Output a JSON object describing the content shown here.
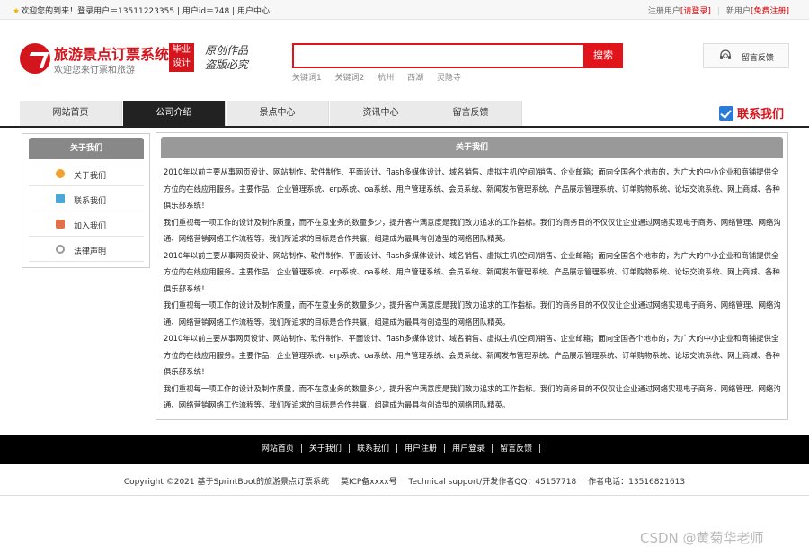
{
  "topbar": {
    "welcome": "欢迎您的到来！登录用户＝13511223355 | 用户id＝748 | 用户中心",
    "register_label": "注册用户",
    "register_link": "[请登录]",
    "new_user_label": "新用户",
    "free_register_link": "[免费注册]"
  },
  "header": {
    "title": "旅游景点订票系统",
    "subtitle": "欢迎您来订票和旅游",
    "grad_badge_line1": "毕业",
    "grad_badge_line2": "设计",
    "slogan_line1": "原创作品",
    "slogan_line2": "盗版必究",
    "search_placeholder": "",
    "search_button": "搜索",
    "keywords": [
      "关键词1",
      "关键词2",
      "杭州",
      "西湖",
      "灵隐寺"
    ],
    "feedback_button": "留言反馈"
  },
  "nav": {
    "items": [
      "网站首页",
      "公司介绍",
      "景点中心",
      "资讯中心",
      "留言反馈"
    ],
    "active_index": 1,
    "contact_us": "联系我们"
  },
  "sidebar": {
    "title": "关于我们",
    "items": [
      {
        "label": "关于我们",
        "icon": "info-icon",
        "color": "#f0a030"
      },
      {
        "label": "联系我们",
        "icon": "document-icon",
        "color": "#4aa7d8"
      },
      {
        "label": "加入我们",
        "icon": "lock-icon",
        "color": "#e0704a"
      },
      {
        "label": "法律声明",
        "icon": "power-icon",
        "color": "#999999"
      }
    ]
  },
  "main": {
    "title": "关于我们",
    "paragraphs": [
      "2010年以前主要从事网页设计、网站制作、软件制作、平面设计、flash多媒体设计、域名销售、虚拟主机(空间)销售、企业邮箱；面向全国各个地市的，为广大的中小企业和商铺提供全方位的在线应用服务。主要作品：企业管理系统、erp系统、oa系统、用户管理系统、会员系统、新闻发布管理系统、产品展示管理系统、订单购物系统、论坛交流系统、网上商城、各种俱乐部系统！",
      "我们重视每一项工作的设计及制作质量，而不在意业务的数量多少，提升客户满意度是我们致力追求的工作指标。我们的商务目的不仅仅让企业通过网络实现电子商务、网络管理、网络沟通、网络营销网络工作流程等。我们所追求的目标是合作共赢，组建成为最具有创造型的网络团队精英。",
      "2010年以前主要从事网页设计、网站制作、软件制作、平面设计、flash多媒体设计、域名销售、虚拟主机(空间)销售、企业邮箱；面向全国各个地市的，为广大的中小企业和商铺提供全方位的在线应用服务。主要作品：企业管理系统、erp系统、oa系统、用户管理系统、会员系统、新闻发布管理系统、产品展示管理系统、订单购物系统、论坛交流系统、网上商城、各种俱乐部系统！",
      "我们重视每一项工作的设计及制作质量，而不在意业务的数量多少，提升客户满意度是我们致力追求的工作指标。我们的商务目的不仅仅让企业通过网络实现电子商务、网络管理、网络沟通、网络营销网络工作流程等。我们所追求的目标是合作共赢，组建成为最具有创造型的网络团队精英。",
      "2010年以前主要从事网页设计、网站制作、软件制作、平面设计、flash多媒体设计、域名销售、虚拟主机(空间)销售、企业邮箱；面向全国各个地市的，为广大的中小企业和商铺提供全方位的在线应用服务。主要作品：企业管理系统、erp系统、oa系统、用户管理系统、会员系统、新闻发布管理系统、产品展示管理系统、订单购物系统、论坛交流系统、网上商城、各种俱乐部系统！",
      "我们重视每一项工作的设计及制作质量，而不在意业务的数量多少，提升客户满意度是我们致力追求的工作指标。我们的商务目的不仅仅让企业通过网络实现电子商务、网络管理、网络沟通、网络营销网络工作流程等。我们所追求的目标是合作共赢，组建成为最具有创造型的网络团队精英。"
    ]
  },
  "footer": {
    "links": [
      "网站首页",
      "关于我们",
      "联系我们",
      "用户注册",
      "用户登录",
      "留言反馈"
    ],
    "copyright": "Copyright ©2021 基于SprintBoot的旅游景点订票系统",
    "icp": "莫ICP备xxxx号",
    "support": "Technical support/开发作者QQ：45157718",
    "phone": "作者电话：13516821613"
  },
  "watermark": "CSDN @黄菊华老师",
  "colors": {
    "brand_red": "#d3151d",
    "search_red": "#e1141b",
    "nav_active": "#222222",
    "footer_bg": "#000000"
  }
}
